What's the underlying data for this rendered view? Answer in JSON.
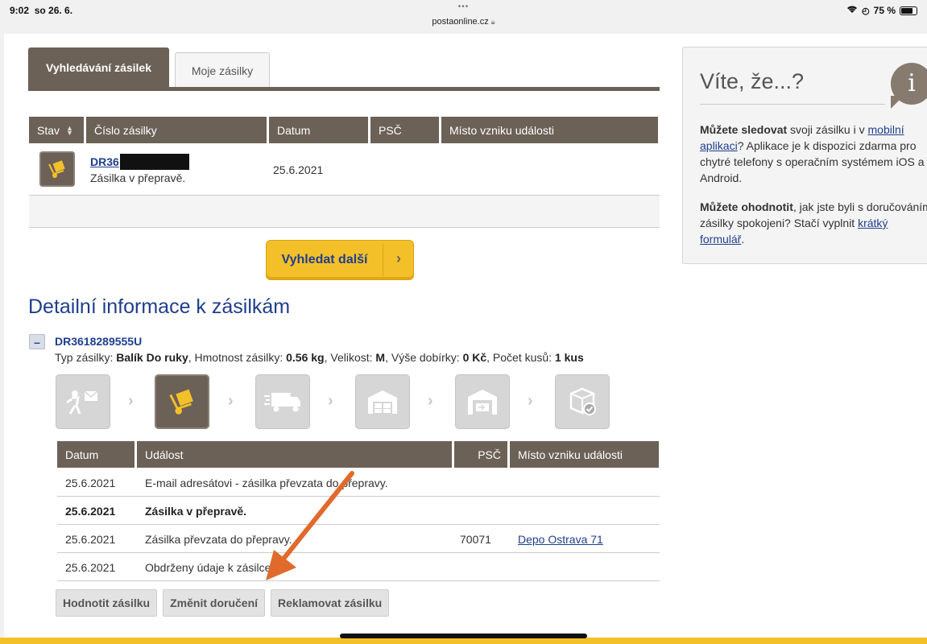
{
  "statusbar": {
    "time": "9:02",
    "date": "so 26. 6.",
    "url": "postaonline.cz",
    "battery": "75 %"
  },
  "tabs": {
    "active": "Vyhledávání zásilek",
    "inactive": "Moje zásilky"
  },
  "search_table": {
    "headers": [
      "Stav",
      "Číslo zásilky",
      "Datum",
      "PSČ",
      "Místo vzniku události"
    ],
    "row": {
      "number_prefix": "DR36",
      "status": "Zásilka v přepravě.",
      "date": "25.6.2021"
    }
  },
  "search_more_label": "Vyhledat další",
  "detail": {
    "title": "Detailní informace k zásilkám",
    "collapse_symbol": "–",
    "number": "DR3618289555U",
    "info": {
      "type_label": "Typ zásilky: ",
      "type": "Balík Do ruky",
      "weight_label": ", Hmotnost zásilky: ",
      "weight": "0.56 kg",
      "size_label": ", Velikost: ",
      "size": "M",
      "cod_label": ", Výše dobírky: ",
      "cod": "0 Kč",
      "count_label": ", Počet kusů: ",
      "count": "1 kus"
    },
    "headers": [
      "Datum",
      "Událost",
      "PSČ",
      "Místo vzniku události"
    ],
    "rows": [
      {
        "date": "25.6.2021",
        "event": "E-mail adresátovi - zásilka převzata do přepravy.",
        "psc": "",
        "place": ""
      },
      {
        "date": "25.6.2021",
        "event": "Zásilka v přepravě.",
        "psc": "",
        "place": ""
      },
      {
        "date": "25.6.2021",
        "event": "Zásilka převzata do přepravy.",
        "psc": "70071",
        "place": "Depo Ostrava 71"
      },
      {
        "date": "25.6.2021",
        "event": "Obdrženy údaje k zásilce.",
        "psc": "",
        "place": ""
      }
    ],
    "buttons": [
      "Hodnotit zásilku",
      "Změnit doručení",
      "Reklamovat zásilku"
    ]
  },
  "sidebar": {
    "title": "Víte, že...?",
    "p1_bold": "Můžete sledovat",
    "p1_text": " svoji zásilku i v ",
    "p1_link": "mobilní aplikaci",
    "p1_rest": "? Aplikace je k dispozici zdarma pro chytré telefony s operačním systémem iOS a Android.",
    "p2_bold": "Můžete ohodnotit",
    "p2_text": ", jak jste byli s doručováním zásilky spokojeni? Stačí vyplnit ",
    "p2_link": "krátký formulář",
    "p2_end": "."
  },
  "colors": {
    "brand_brown": "#6b6157",
    "brand_yellow": "#f4c02a",
    "link_blue": "#1f3e8c",
    "annotation_arrow": "#e06a2c"
  }
}
